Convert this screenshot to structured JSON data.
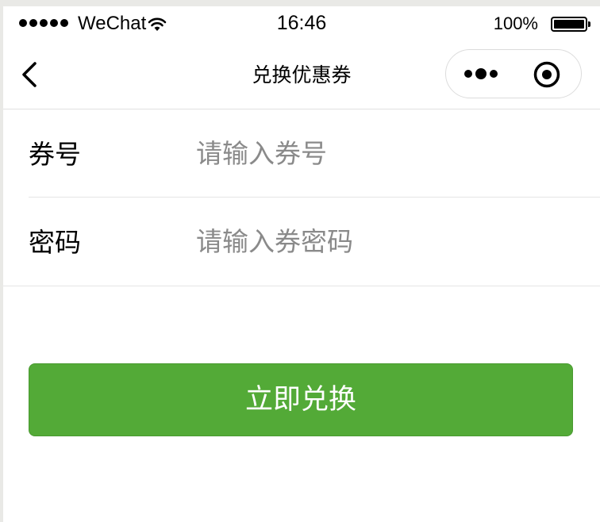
{
  "status_bar": {
    "carrier": "WeChat",
    "time": "16:46",
    "battery_pct": "100%",
    "signal_icon": "signal-dots-icon",
    "wifi_icon": "wifi-icon",
    "battery_icon": "battery-icon"
  },
  "nav": {
    "title": "兑换优惠券",
    "back_icon": "chevron-left-icon",
    "more_icon": "more-dots-icon",
    "close_icon": "target-circle-icon"
  },
  "form": {
    "coupon_number": {
      "label": "券号",
      "value": "",
      "placeholder": "请输入券号"
    },
    "password": {
      "label": "密码",
      "value": "",
      "placeholder": "请输入券密码"
    }
  },
  "actions": {
    "redeem_label": "立即兑换"
  },
  "colors": {
    "accent": "#53aa37",
    "placeholder": "#8a8a8a",
    "divider": "#e5e5e5",
    "background": "#ffffff",
    "outer_background": "#e9e9e6"
  }
}
